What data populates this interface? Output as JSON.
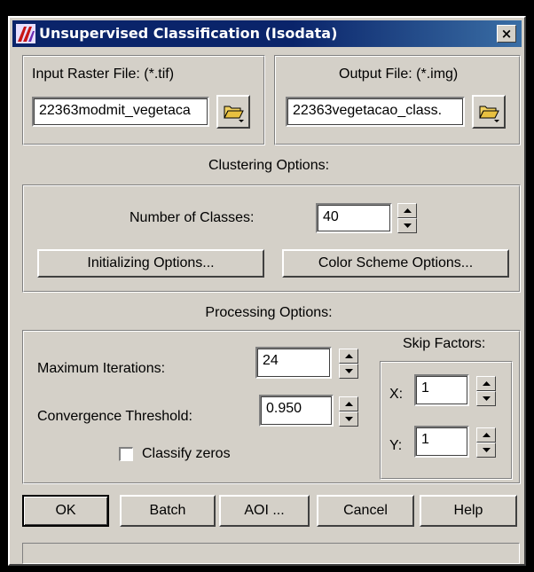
{
  "window": {
    "title": "Unsupervised Classification (Isodata)",
    "close_label": "×"
  },
  "input": {
    "label": "Input Raster File: (*.tif)",
    "value": "22363modmit_vegetaca"
  },
  "output": {
    "label": "Output File: (*.img)",
    "value": "22363vegetacao_class."
  },
  "clustering": {
    "heading": "Clustering Options:",
    "num_classes_label": "Number of Classes:",
    "num_classes_value": "40",
    "init_button": "Initializing Options...",
    "color_button": "Color Scheme Options..."
  },
  "processing": {
    "heading": "Processing Options:",
    "max_iter_label": "Maximum Iterations:",
    "max_iter_value": "24",
    "conv_label": "Convergence Threshold:",
    "conv_value": "0.950",
    "classify_zeros_label": "Classify zeros",
    "classify_zeros_checked": false,
    "skip_heading": "Skip Factors:",
    "x_label": "X:",
    "x_value": "1",
    "y_label": "Y:",
    "y_value": "1"
  },
  "buttons": {
    "ok": "OK",
    "batch": "Batch",
    "aoi": "AOI ...",
    "cancel": "Cancel",
    "help": "Help"
  },
  "status": {
    "text": ""
  }
}
